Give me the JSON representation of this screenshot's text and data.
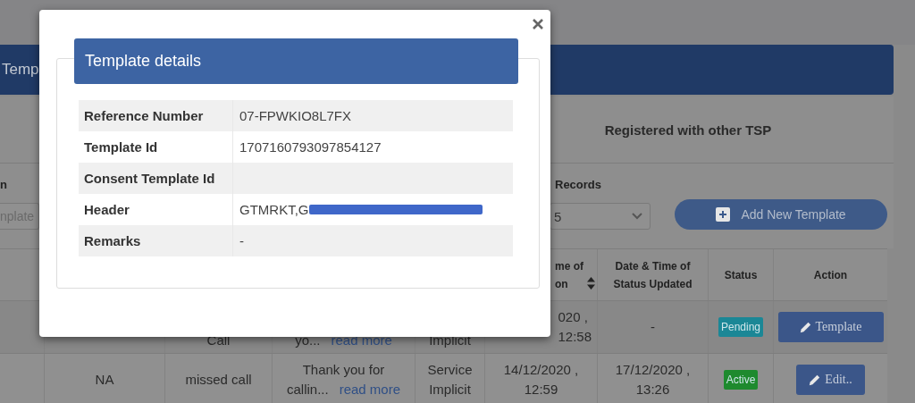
{
  "header": {
    "title": "Temp"
  },
  "tabs": [
    {
      "label": "Registered with other TSP",
      "selected": false
    }
  ],
  "filters": {
    "search_label": "n",
    "search_placeholder": "nplate",
    "records_label": "Records",
    "records_value": "5",
    "add_button": "Add New Template"
  },
  "table": {
    "columns": [
      null,
      null,
      null,
      null,
      null,
      {
        "lines": [
          "me of",
          "on"
        ],
        "sortable": true
      },
      {
        "lines": [
          "Date & Time of",
          "Status Updated"
        ],
        "sortable": false
      },
      {
        "lines": [
          "Status"
        ],
        "sortable": false
      },
      {
        "lines": [
          "Action"
        ],
        "sortable": false
      }
    ],
    "rows": [
      {
        "cells": [
          null,
          null,
          {
            "kind": "text",
            "lines": [
              "Call"
            ]
          },
          {
            "kind": "message",
            "lines": [
              "yo..."
            ],
            "link": "read more"
          },
          {
            "kind": "text",
            "lines": [
              "Implicit"
            ]
          },
          {
            "kind": "text",
            "lines": [
              "020 ,",
              "12:58"
            ]
          },
          {
            "kind": "text",
            "lines": [
              "-"
            ]
          },
          {
            "kind": "badge",
            "label": "Pending",
            "color": "#1b8796"
          },
          {
            "kind": "button",
            "label": "Template"
          }
        ]
      },
      {
        "cells": [
          null,
          {
            "kind": "text",
            "lines": [
              "NA"
            ]
          },
          {
            "kind": "text",
            "lines": [
              "missed call"
            ]
          },
          {
            "kind": "message",
            "lines": [
              "Thank you for",
              "callin..."
            ],
            "link": "read more"
          },
          {
            "kind": "text",
            "lines": [
              "Service",
              "Implicit"
            ]
          },
          {
            "kind": "text",
            "lines": [
              "14/12/2020 ,",
              "12:59"
            ]
          },
          {
            "kind": "text",
            "lines": [
              "17/12/2020 ,",
              "13:26"
            ]
          },
          {
            "kind": "badge",
            "label": "Active",
            "color": "#1e8a2e"
          },
          {
            "kind": "button",
            "label": "Edit.."
          }
        ]
      }
    ]
  },
  "modal": {
    "title": "Template details",
    "details": [
      {
        "label": "Reference Number",
        "value": "07-FPWKIO8L7FX"
      },
      {
        "label": "Template Id",
        "value": "1707160793097854127"
      },
      {
        "label": "Consent Template Id"
      },
      {
        "label": "Header",
        "value": "GTMRKT,G",
        "redacted": true
      },
      {
        "label": "Remarks",
        "value": "-"
      }
    ]
  }
}
